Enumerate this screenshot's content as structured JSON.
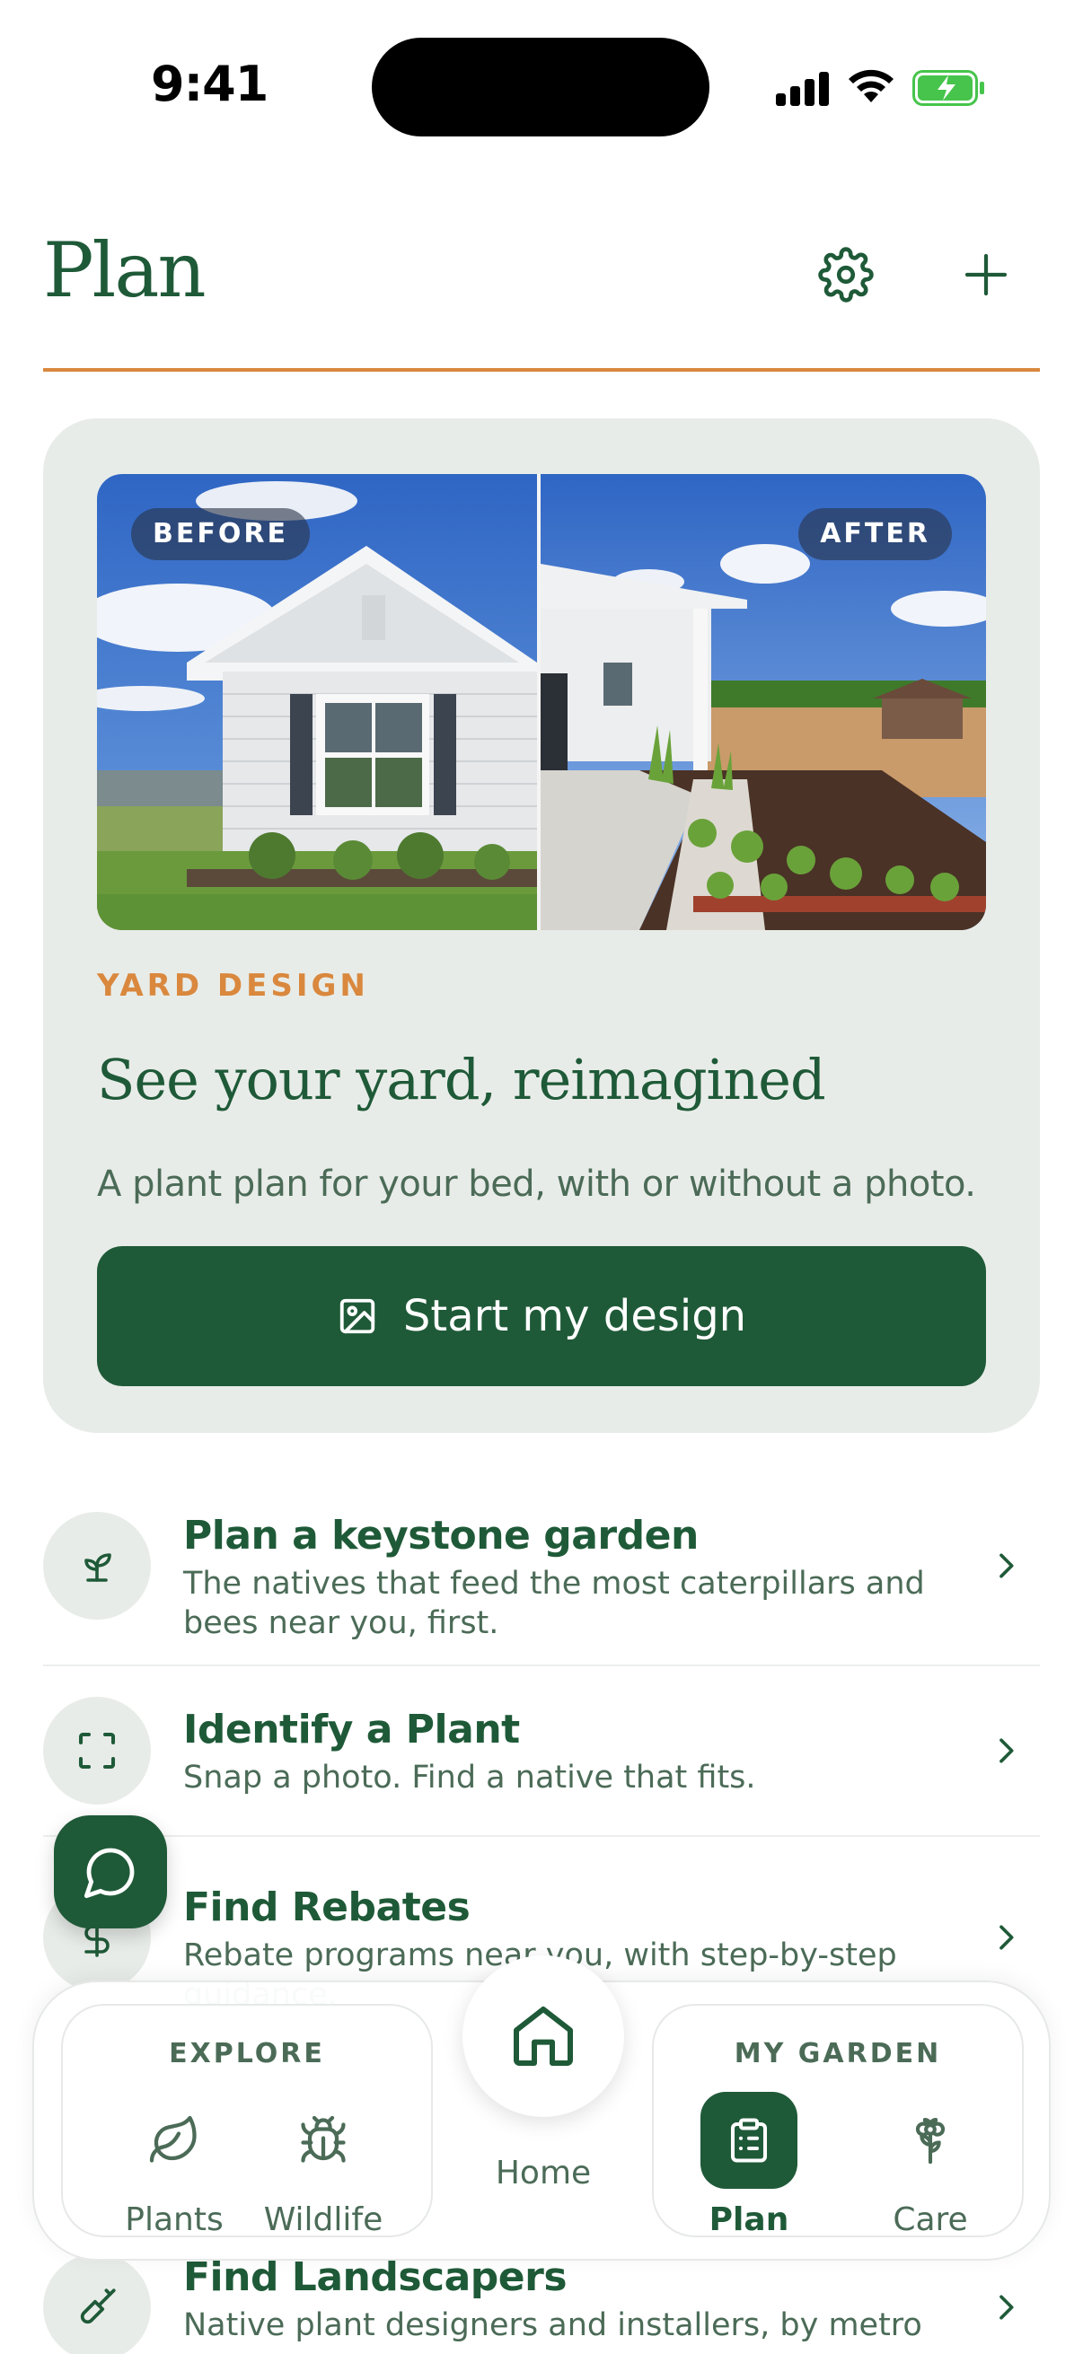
{
  "status_bar": {
    "time": "9:41"
  },
  "header": {
    "title": "Plan",
    "settings_icon": "gear-icon",
    "add_icon": "plus-icon"
  },
  "design_card": {
    "before_label": "BEFORE",
    "after_label": "AFTER",
    "eyebrow": "YARD DESIGN",
    "headline": "See your yard, reimagined",
    "subtitle": "A plant plan for your bed, with or without a photo.",
    "button_label": "Start my design",
    "button_icon": "image-icon"
  },
  "list": [
    {
      "title": "Plan a keystone garden",
      "desc": "The natives that feed the most caterpillars and bees near you, first.",
      "icon": "sprout-icon"
    },
    {
      "title": "Identify a Plant",
      "desc": "Snap a photo. Find a native that fits.",
      "icon": "scan-icon"
    },
    {
      "title": "Find Rebates",
      "desc": "Rebate programs near you, with step-by-step guidance.",
      "icon": "dollar-icon"
    },
    {
      "title": "Find Landscapers",
      "desc": "Native plant designers and installers, by metro area.",
      "icon": "shovel-icon"
    }
  ],
  "bottom_nav": {
    "explore_label": "EXPLORE",
    "garden_label": "MY GARDEN",
    "items": {
      "plants": "Plants",
      "wildlife": "Wildlife",
      "home": "Home",
      "plan": "Plan",
      "care": "Care"
    }
  },
  "colors": {
    "brand_green": "#1f5a38",
    "accent_orange": "#d9883e",
    "card_bg": "#e8ece8"
  }
}
